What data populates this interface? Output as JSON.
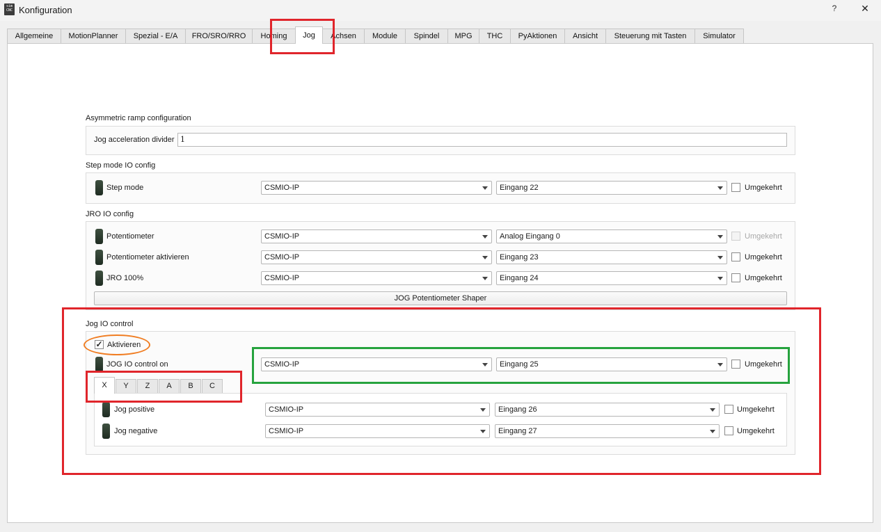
{
  "window": {
    "app_icon_text": [
      "sim",
      "CNC"
    ],
    "title": "Konfiguration",
    "help_label": "?",
    "close_label": "✕"
  },
  "tabs": [
    {
      "label": "Allgemeine",
      "active": false
    },
    {
      "label": "MotionPlanner",
      "active": false
    },
    {
      "label": "Spezial - E/A",
      "active": false
    },
    {
      "label": "FRO/SRO/RRO",
      "active": false
    },
    {
      "label": "Homing",
      "active": false
    },
    {
      "label": "Jog",
      "active": true
    },
    {
      "label": "Achsen",
      "active": false
    },
    {
      "label": "Module",
      "active": false
    },
    {
      "label": "Spindel",
      "active": false
    },
    {
      "label": "MPG",
      "active": false
    },
    {
      "label": "THC",
      "active": false
    },
    {
      "label": "PyAktionen",
      "active": false
    },
    {
      "label": "Ansicht",
      "active": false
    },
    {
      "label": "Steuerung mit Tasten",
      "active": false
    },
    {
      "label": "Simulator",
      "active": false
    }
  ],
  "asymmetric_ramp": {
    "title": "Asymmetric ramp configuration",
    "divider_label": "Jog acceleration divider",
    "divider_value": "1"
  },
  "step_mode": {
    "title": "Step mode IO config",
    "rows": [
      {
        "label": "Step mode",
        "device": "CSMIO-IP",
        "input": "Eingang 22",
        "inverted_label": "Umgekehrt",
        "inverted": false,
        "inverted_enabled": true
      }
    ]
  },
  "jro": {
    "title": "JRO IO config",
    "rows": [
      {
        "label": "Potentiometer",
        "device": "CSMIO-IP",
        "input": "Analog Eingang 0",
        "inverted_label": "Umgekehrt",
        "inverted": false,
        "inverted_enabled": false
      },
      {
        "label": "Potentiometer aktivieren",
        "device": "CSMIO-IP",
        "input": "Eingang 23",
        "inverted_label": "Umgekehrt",
        "inverted": false,
        "inverted_enabled": true
      },
      {
        "label": "JRO 100%",
        "device": "CSMIO-IP",
        "input": "Eingang 24",
        "inverted_label": "Umgekehrt",
        "inverted": false,
        "inverted_enabled": true
      }
    ],
    "shaper_button": "JOG Potentiometer Shaper"
  },
  "jog_io": {
    "title": "Jog IO control",
    "enable_label": "Aktivieren",
    "enable_checked": true,
    "checkmark": "✓",
    "control_on": {
      "label": "JOG IO control on",
      "device": "CSMIO-IP",
      "input": "Eingang 25",
      "inverted_label": "Umgekehrt",
      "inverted": false
    },
    "axis_tabs": [
      "X",
      "Y",
      "Z",
      "A",
      "B",
      "C"
    ],
    "active_axis": "X",
    "axis_rows": [
      {
        "label": "Jog positive",
        "device": "CSMIO-IP",
        "input": "Eingang 26",
        "inverted_label": "Umgekehrt",
        "inverted": false
      },
      {
        "label": "Jog negative",
        "device": "CSMIO-IP",
        "input": "Eingang 27",
        "inverted_label": "Umgekehrt",
        "inverted": false
      }
    ]
  },
  "colors": {
    "annotation_red": "#e0252b",
    "annotation_green": "#26a33e",
    "annotation_orange": "#f07d22",
    "indicator": "#2c3a2e"
  }
}
